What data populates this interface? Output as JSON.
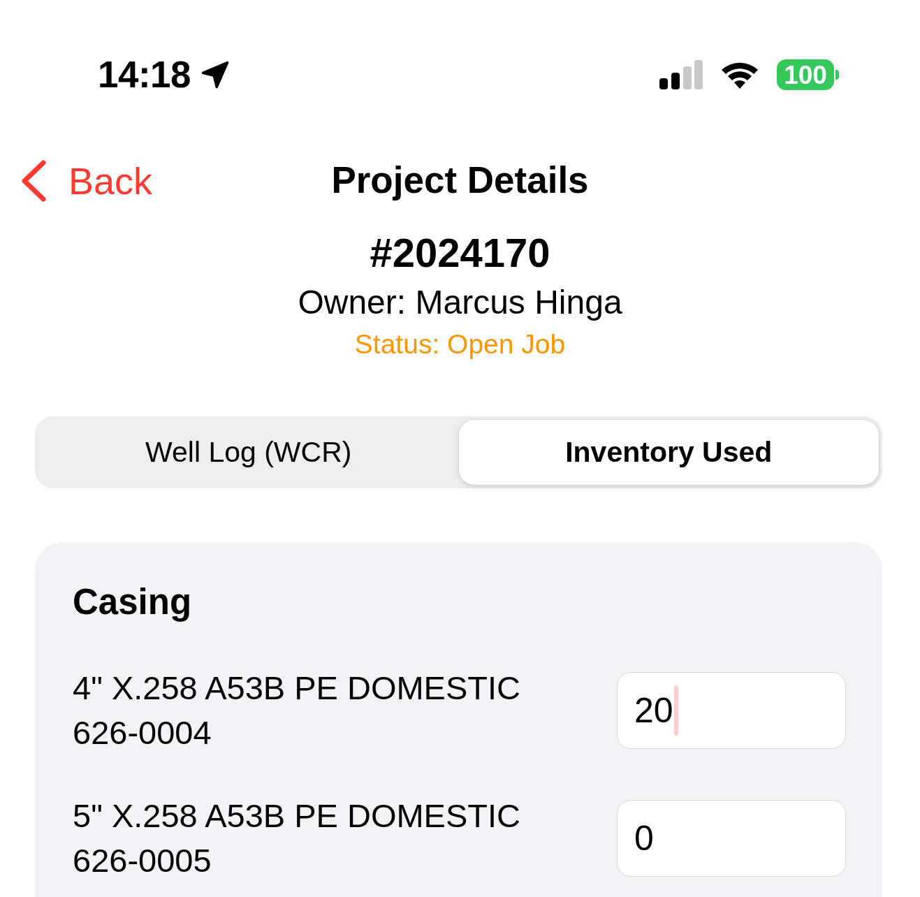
{
  "status_bar": {
    "time": "14:18",
    "battery": "100"
  },
  "nav": {
    "back": "Back",
    "title": "Project Details"
  },
  "project": {
    "number": "#2024170",
    "owner": "Owner: Marcus Hinga",
    "status": "Status: Open Job"
  },
  "tabs": [
    {
      "label": "Well Log (WCR)",
      "selected": false
    },
    {
      "label": "Inventory Used",
      "selected": true
    }
  ],
  "section": {
    "title": "Casing",
    "items": [
      {
        "name": "4\" X.258 A53B PE DOMESTIC",
        "code": "626-0004",
        "quantity": "20",
        "focused": true
      },
      {
        "name": "5\" X.258 A53B PE DOMESTIC",
        "code": "626-0005",
        "quantity": "0",
        "focused": false
      }
    ]
  }
}
